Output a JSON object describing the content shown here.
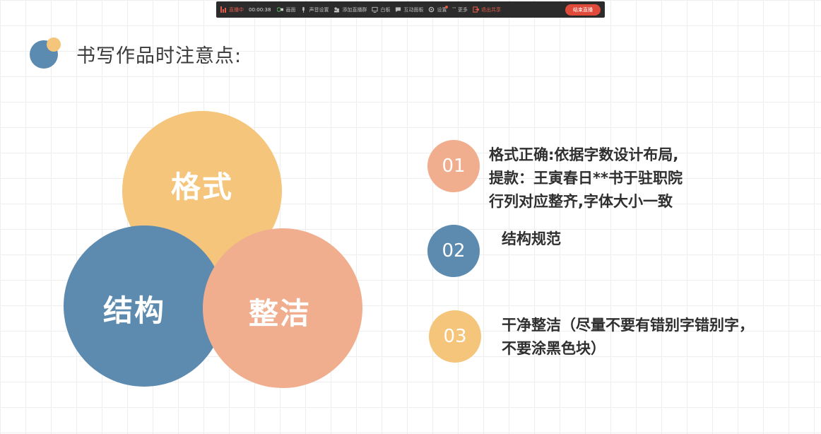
{
  "toolbar": {
    "live_label": "直播中",
    "time": "00:00:38",
    "items": [
      "画面",
      "声音设置",
      "添加直播群",
      "白板",
      "互动面板",
      "设置",
      "更多"
    ],
    "exit_share": "退出共享",
    "end_live": "结束直播",
    "colors": {
      "background": "#2b2b2b",
      "accent": "#e25b4a"
    }
  },
  "title": "书写作品时注意点:",
  "venn": {
    "format": "格式",
    "structure": "结构",
    "clean": "整洁",
    "colors": {
      "format": "#f4c57a",
      "structure": "#5d8bb0",
      "clean": "#f0ae8e"
    }
  },
  "points": [
    {
      "number": "01",
      "lines": [
        "格式正确:依据字数设计布局,",
        "提款：王寅春日**书于驻职院",
        "行列对应整齐,字体大小一致"
      ]
    },
    {
      "number": "02",
      "lines": [
        "结构规范"
      ]
    },
    {
      "number": "03",
      "lines": [
        "干净整洁（尽量不要有错别字错别字，",
        "不要涂黑色块）"
      ]
    }
  ]
}
